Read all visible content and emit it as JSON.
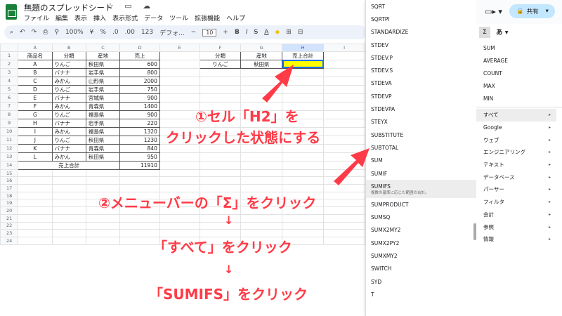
{
  "doc": {
    "title": "無題のスプレッドシート",
    "star": "☆",
    "folder": "▭",
    "cloud": "☁"
  },
  "menu": [
    "ファイル",
    "編集",
    "表示",
    "挿入",
    "表示形式",
    "データ",
    "ツール",
    "拡張機能",
    "ヘルプ"
  ],
  "toolbar": {
    "search": "⌕",
    "undo": "↶",
    "redo": "↷",
    "print": "⎙",
    "paint": "⚲",
    "zoom": "100%",
    "currency": "¥",
    "percent": "%",
    "dec_minus": ".0",
    "dec_plus": ".00",
    "num123": "123",
    "font": "デフォ...",
    "size_minus": "−",
    "size": "10",
    "size_plus": "+",
    "bold": "B",
    "italic": "I",
    "strike": "S",
    "textcolor": "A",
    "fill": "◆",
    "borders": "⊞",
    "merge": "⊟"
  },
  "columns": [
    "",
    "A",
    "B",
    "C",
    "D",
    "E",
    "F",
    "G",
    "H",
    "I"
  ],
  "rows": [
    {
      "n": "1",
      "a": "商品名",
      "b": "分類",
      "c": "産地",
      "d": "売上",
      "f": "分類",
      "g": "産地",
      "h": "売上合計"
    },
    {
      "n": "2",
      "a": "A",
      "b": "りんご",
      "c": "秋田県",
      "d": "600",
      "f": "りんご",
      "g": "秋田県",
      "h": ""
    },
    {
      "n": "3",
      "a": "B",
      "b": "バナナ",
      "c": "岩手県",
      "d": "800"
    },
    {
      "n": "4",
      "a": "C",
      "b": "みかん",
      "c": "山形県",
      "d": "2000"
    },
    {
      "n": "5",
      "a": "D",
      "b": "りんご",
      "c": "岩手県",
      "d": "750"
    },
    {
      "n": "6",
      "a": "E",
      "b": "バナナ",
      "c": "宮城県",
      "d": "900"
    },
    {
      "n": "7",
      "a": "F",
      "b": "みかん",
      "c": "青森県",
      "d": "1400"
    },
    {
      "n": "8",
      "a": "G",
      "b": "りんご",
      "c": "福島県",
      "d": "900"
    },
    {
      "n": "9",
      "a": "H",
      "b": "バナナ",
      "c": "岩手県",
      "d": "220"
    },
    {
      "n": "10",
      "a": "I",
      "b": "みかん",
      "c": "福島県",
      "d": "1320"
    },
    {
      "n": "11",
      "a": "J",
      "b": "りんご",
      "c": "秋田県",
      "d": "1230"
    },
    {
      "n": "12",
      "a": "K",
      "b": "バナナ",
      "c": "青森県",
      "d": "840"
    },
    {
      "n": "13",
      "a": "L",
      "b": "みかん",
      "c": "秋田県",
      "d": "950"
    },
    {
      "n": "14",
      "a": "売上合計",
      "b": "",
      "c": "",
      "d": "11910"
    },
    {
      "n": "15"
    },
    {
      "n": "16"
    },
    {
      "n": "17"
    },
    {
      "n": "18"
    },
    {
      "n": "19"
    },
    {
      "n": "20"
    },
    {
      "n": "21"
    },
    {
      "n": "22"
    },
    {
      "n": "23"
    },
    {
      "n": "24"
    }
  ],
  "functions": [
    "SQRT",
    "SQRTPI",
    "STANDARDIZE",
    "STDEV",
    "STDEV.P",
    "STDEV.S",
    "STDEVA",
    "STDEVP",
    "STDEVPA",
    "STEYX",
    "SUBSTITUTE",
    "SUBTOTAL",
    "SUM",
    "SUMIF",
    "SUMIFS",
    "SUMPRODUCT",
    "SUMSQ",
    "SUMX2MY2",
    "SUMX2PY2",
    "SUMXMY2",
    "SWITCH",
    "SYD",
    "T"
  ],
  "sumifs_desc": "複数の基準に応じた範囲の合計。",
  "right": {
    "video": "▭▸ ▾",
    "share_icon": "🔒",
    "share": "共有",
    "share_arrow": "▾",
    "sigma": "Σ",
    "a_label": "あ ▾",
    "quick": [
      "SUM",
      "AVERAGE",
      "COUNT",
      "MAX",
      "MIN"
    ],
    "categories": [
      "すべて",
      "Google",
      "ウェブ",
      "エンジニアリング",
      "テキスト",
      "データベース",
      "パーサー",
      "フィルタ",
      "会計",
      "参照",
      "情報"
    ],
    "chevron": "▸"
  },
  "annotations": {
    "step1_line1": "①セル「H2」を",
    "step1_line2": "クリックした状態にする",
    "step2": "②メニューバーの「Σ」をクリック",
    "down1": "↓",
    "step3": "「すべて」をクリック",
    "down2": "↓",
    "step4": "「SUMIFS」をクリック"
  },
  "colors": {
    "accent": "#ff3b47",
    "selection": "#1a73e8",
    "highlight_fill": "#ffff00"
  }
}
